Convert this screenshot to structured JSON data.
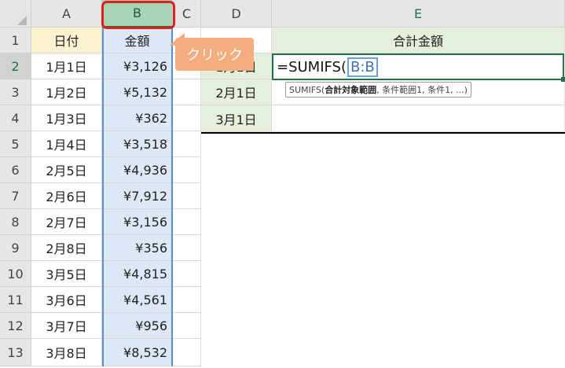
{
  "sheet": {
    "columns": [
      "A",
      "B",
      "C",
      "D",
      "E"
    ],
    "rows": [
      "1",
      "2",
      "3",
      "4",
      "5",
      "6",
      "7",
      "8",
      "9",
      "10",
      "11",
      "12",
      "13"
    ],
    "headers": {
      "a1": "日付",
      "b1": "金額",
      "e1": "合計金額"
    },
    "colA_dates": [
      "1月1日",
      "1月2日",
      "1月3日",
      "1月4日",
      "2月5日",
      "2月6日",
      "2月7日",
      "2月8日",
      "3月5日",
      "3月6日",
      "3月7日",
      "3月8日"
    ],
    "colB_amounts": [
      "¥3,126",
      "¥5,132",
      "¥362",
      "¥3,518",
      "¥4,936",
      "¥7,912",
      "¥3,156",
      "¥356",
      "¥4,815",
      "¥4,561",
      "¥956",
      "¥8,532"
    ],
    "colD_dates": [
      "1月1日",
      "2月1日",
      "3月1日"
    ]
  },
  "editing": {
    "formula_prefix": "=SUMIFS(",
    "formula_range": "B:B",
    "tooltip_func": "SUMIFS(",
    "tooltip_bold_arg": "合計対象範囲",
    "tooltip_rest": ", 条件範囲1, 条件1, ...)"
  },
  "annotation": {
    "callout": "クリック"
  },
  "colors": {
    "selection_green": "#217346",
    "highlight_red": "#e0201c",
    "callout_orange": "#f4ad7e"
  }
}
